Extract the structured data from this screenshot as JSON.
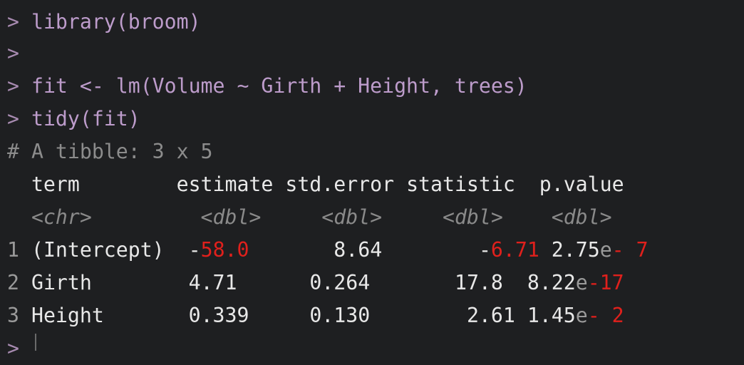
{
  "console": {
    "prompt": ">",
    "comment_mark": "#",
    "commands": [
      "library(broom)",
      "",
      "fit <- lm(Volume ~ Girth + Height, trees)",
      "tidy(fit)"
    ],
    "tibble_header": "A tibble: 3 x 5",
    "columns": [
      "term",
      "estimate",
      "std.error",
      "statistic",
      "p.value"
    ],
    "types": [
      "<chr>",
      "<dbl>",
      "<dbl>",
      "<dbl>",
      "<dbl>"
    ],
    "rows": [
      {
        "index": "1",
        "term": "(Intercept)",
        "estimate_sign": "-",
        "estimate": "58.0",
        "std_error": "8.64",
        "statistic_sign": "-",
        "statistic": "6.71",
        "p_mantissa": "2.75",
        "p_e": "e",
        "p_exp": "- 7"
      },
      {
        "index": "2",
        "term": "Girth",
        "estimate_sign": "",
        "estimate": "4.71",
        "std_error": "0.264",
        "statistic_sign": "",
        "statistic": "17.8",
        "p_mantissa": "8.22",
        "p_e": "e",
        "p_exp": "-17"
      },
      {
        "index": "3",
        "term": "Height",
        "estimate_sign": "",
        "estimate": "0.339",
        "std_error": "0.130",
        "statistic_sign": "",
        "statistic": "2.61",
        "p_mantissa": "1.45",
        "p_e": "e",
        "p_exp": "- 2"
      }
    ]
  }
}
